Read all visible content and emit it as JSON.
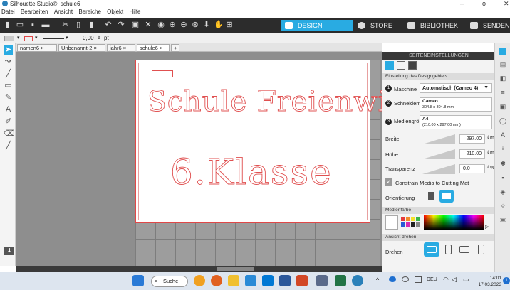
{
  "window": {
    "title": "Silhouette Studio®: schule6",
    "min": "–",
    "max": "ɵ",
    "close": "✕"
  },
  "menu": [
    "Datei",
    "Bearbeiten",
    "Ansicht",
    "Bereiche",
    "Objekt",
    "Hilfe"
  ],
  "nav": {
    "design": "DESIGN",
    "store": "STORE",
    "library": "BIBLIOTHEK",
    "send": "SENDEN"
  },
  "options": {
    "line_width": "0,00",
    "unit": "pt"
  },
  "tabs": [
    "namen6",
    "Unbenannt-2",
    "jahr6",
    "schule6"
  ],
  "tab_add": "+",
  "design": {
    "line1": "Schule Freienwil",
    "line2": "6.Klasse"
  },
  "panel": {
    "title": "SEITENEINSTELLUNGEN",
    "section_setup": "Einstellung des Designgebiets",
    "machine_label": "Maschine",
    "machine_value": "Automatisch (Cameo 4)",
    "cutmat_label": "Schneidematte",
    "cutmat_value": "Cameo",
    "cutmat_size": "304.8 x 304.8 mm",
    "media_label": "Mediengröße",
    "media_value": "A4",
    "media_size": "(210.00 x 297.00 mm)",
    "width_label": "Breite",
    "width_value": "297.00",
    "width_unit": "mm",
    "height_label": "Höhe",
    "height_value": "210.00",
    "height_unit": "mm",
    "transp_label": "Transparenz",
    "transp_value": "0.0",
    "transp_unit": "%",
    "constrain_label": "Constrain Media to Cutting Mat",
    "orient_label": "Orientierung",
    "section_color": "Medienfarbe",
    "section_rotate": "Ansicht drehen",
    "rotate_label": "Drehen"
  },
  "taskbar": {
    "search": "Suche",
    "lang": "DEU",
    "time": "14:01",
    "date": "17.03.2023",
    "badge": "1"
  },
  "colors": {
    "accent": "#29abe2",
    "outline": "#e05050",
    "toolbar": "#2c2c2c"
  }
}
